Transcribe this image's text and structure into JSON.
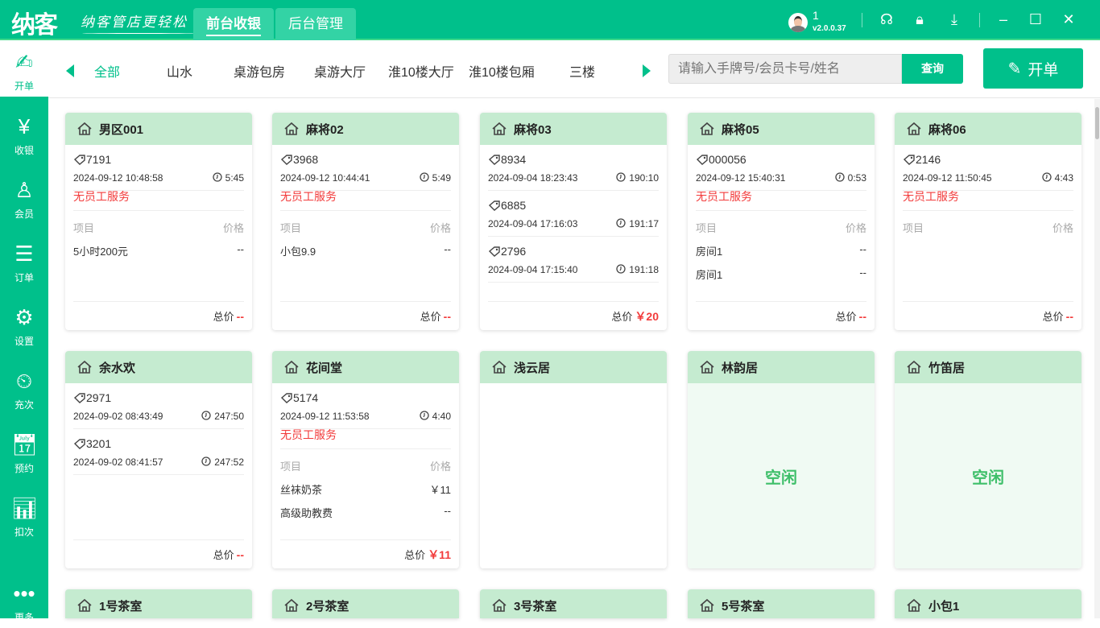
{
  "header": {
    "logo": "纳客",
    "slogan": "纳客管店更轻松",
    "tabs": [
      {
        "label": "前台收银"
      },
      {
        "label": "后台管理"
      }
    ],
    "user": "1",
    "version": "v2.0.0.37"
  },
  "sidebar": [
    {
      "label": "开单",
      "icon": "edit-icon"
    },
    {
      "label": "收银",
      "icon": "cashier-icon"
    },
    {
      "label": "会员",
      "icon": "member-icon"
    },
    {
      "label": "订单",
      "icon": "order-icon"
    },
    {
      "label": "设置",
      "icon": "gear-icon"
    },
    {
      "label": "充次",
      "icon": "recharge-icon"
    },
    {
      "label": "预约",
      "icon": "calendar-icon"
    },
    {
      "label": "扣次",
      "icon": "chart-icon"
    },
    {
      "label": "更多",
      "icon": "more-icon"
    }
  ],
  "categories": [
    "全部",
    "山水",
    "桌游包房",
    "桌游大厅",
    "淮10楼大厅",
    "淮10楼包厢",
    "三楼"
  ],
  "search": {
    "placeholder": "请输入手牌号/会员卡号/姓名",
    "button": "查询"
  },
  "open_button": "开单",
  "labels": {
    "item": "项目",
    "price": "价格",
    "total": "总价",
    "no_staff": "无员工服务",
    "idle": "空闲"
  },
  "cards": [
    {
      "name": "男区001",
      "orders": [
        {
          "code": "7191",
          "time": "2024-09-12 10:48:58",
          "dur": "5:45"
        }
      ],
      "no_staff": true,
      "items": [
        {
          "n": "5小时200元",
          "p": "--"
        }
      ],
      "total": "--"
    },
    {
      "name": "麻将02",
      "orders": [
        {
          "code": "3968",
          "time": "2024-09-12 10:44:41",
          "dur": "5:49"
        }
      ],
      "no_staff": true,
      "items": [
        {
          "n": "小包9.9",
          "p": "--"
        }
      ],
      "total": "--"
    },
    {
      "name": "麻将03",
      "orders": [
        {
          "code": "8934",
          "time": "2024-09-04 18:23:43",
          "dur": "190:10"
        },
        {
          "code": "6885",
          "time": "2024-09-04 17:16:03",
          "dur": "191:17"
        },
        {
          "code": "2796",
          "time": "2024-09-04 17:15:40",
          "dur": "191:18"
        }
      ],
      "no_staff": false,
      "items": null,
      "total": "￥20"
    },
    {
      "name": "麻将05",
      "orders": [
        {
          "code": "000056",
          "time": "2024-09-12 15:40:31",
          "dur": "0:53"
        }
      ],
      "no_staff": true,
      "items": [
        {
          "n": "房间1",
          "p": "--"
        },
        {
          "n": "房间1",
          "p": "--"
        }
      ],
      "total": "--"
    },
    {
      "name": "麻将06",
      "orders": [
        {
          "code": "2146",
          "time": "2024-09-12 11:50:45",
          "dur": "4:43"
        }
      ],
      "no_staff": true,
      "items": [],
      "total": "--"
    },
    {
      "name": "余水欢",
      "orders": [
        {
          "code": "2971",
          "time": "2024-09-02 08:43:49",
          "dur": "247:50"
        },
        {
          "code": "3201",
          "time": "2024-09-02 08:41:57",
          "dur": "247:52"
        }
      ],
      "no_staff": false,
      "items": null,
      "total": "--"
    },
    {
      "name": "花间堂",
      "orders": [
        {
          "code": "5174",
          "time": "2024-09-12 11:53:58",
          "dur": "4:40"
        }
      ],
      "no_staff": true,
      "items": [
        {
          "n": "丝袜奶茶",
          "p": "￥11"
        },
        {
          "n": "高级助教费",
          "p": "--"
        }
      ],
      "total": "￥11"
    },
    {
      "name": "浅云居",
      "status": "blank"
    },
    {
      "name": "林韵居",
      "status": "idle"
    },
    {
      "name": "竹笛居",
      "status": "idle"
    },
    {
      "name": "1号茶室",
      "status": "blank"
    },
    {
      "name": "2号茶室",
      "status": "blank"
    },
    {
      "name": "3号茶室",
      "status": "blank"
    },
    {
      "name": "5号茶室",
      "status": "blank"
    },
    {
      "name": "小包1",
      "status": "blank"
    }
  ],
  "colors": {
    "brand": "#00c08b",
    "header_bg": "#c5ebd0",
    "red": "#f23b3b"
  }
}
